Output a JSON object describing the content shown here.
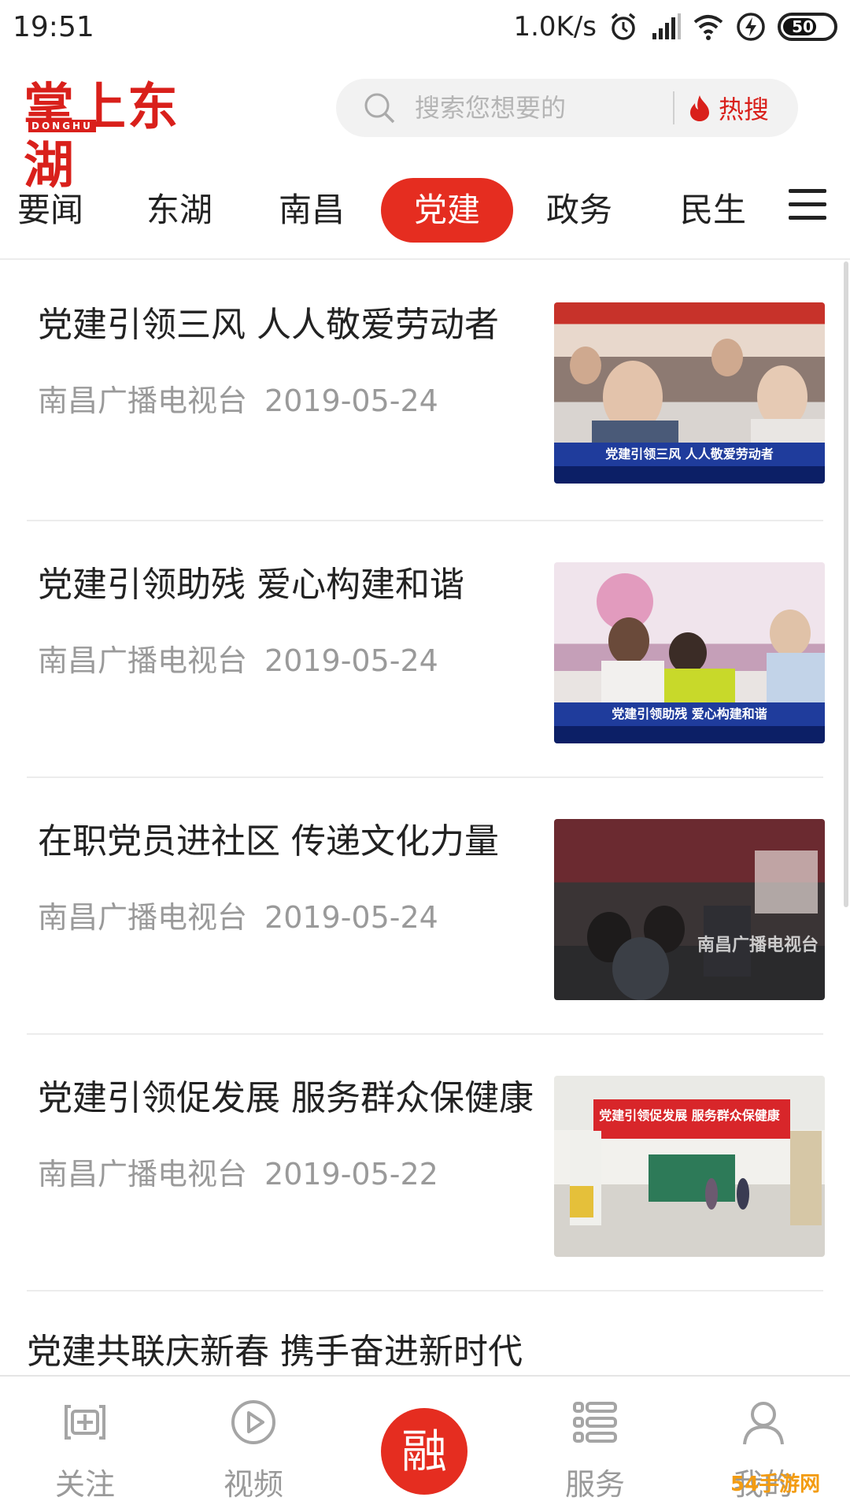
{
  "status_bar": {
    "time": "19:51",
    "speed": "1.0K/s",
    "battery": "50"
  },
  "header": {
    "logo_text": "掌上东湖",
    "logo_sub": "DONGHU",
    "search_placeholder": "搜索您想要的",
    "hot_label": "热搜"
  },
  "tabs": [
    "要闻",
    "东湖",
    "南昌",
    "党建",
    "政务",
    "民生"
  ],
  "active_tab": "党建",
  "news": [
    {
      "title": "党建引领三风 人人敬爱劳动者",
      "source": "南昌广播电视台",
      "date": "2019-05-24",
      "caption": "党建引领三风  人人敬爱劳动者"
    },
    {
      "title": "党建引领助残 爱心构建和谐",
      "source": "南昌广播电视台",
      "date": "2019-05-24",
      "caption": "党建引领助残  爱心构建和谐"
    },
    {
      "title": "在职党员进社区 传递文化力量",
      "source": "南昌广播电视台",
      "date": "2019-05-24",
      "caption": "南昌广播电视台"
    },
    {
      "title": "党建引领促发展 服务群众保健康",
      "source": "南昌广播电视台",
      "date": "2019-05-22",
      "caption": "党建引领促发展  服务群众保健康"
    },
    {
      "title": "党建共联庆新春 携手奋进新时代"
    }
  ],
  "bottom_nav": {
    "follow": "关注",
    "video": "视频",
    "center": "融",
    "service": "服务",
    "mine": "我的"
  },
  "watermark": "54手游网",
  "colors": {
    "accent": "#e52d20",
    "logo": "#d9201b"
  }
}
